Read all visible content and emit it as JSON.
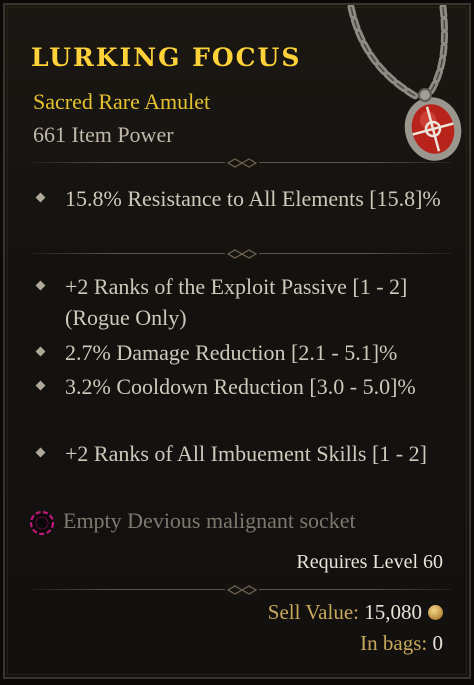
{
  "item": {
    "name": "Lurking Focus",
    "type": "Sacred Rare Amulet",
    "item_power": "661 Item Power",
    "implicit_affixes": [
      "15.8% Resistance to All Elements [15.8]%"
    ],
    "affixes": [
      "+2 Ranks of the Exploit Passive [1 - 2] (Rogue Only)",
      "2.7% Damage Reduction [2.1 - 5.1]%",
      "3.2% Cooldown Reduction [3.0 - 5.0]%",
      "+2 Ranks of All Imbuement Skills [1 - 2]"
    ],
    "socket": "Empty Devious malignant socket",
    "requirement": "Requires Level 60",
    "sell_label": "Sell Value:",
    "sell_value": "15,080",
    "bags_label": "In bags:",
    "bags_value": "0"
  },
  "icons": {
    "affix_bullet": "diamond-bullet-icon",
    "socket": "malignant-socket-icon",
    "gold": "gold-coin-icon",
    "item": "amulet-icon"
  },
  "colors": {
    "rare_name": "#ffd23a",
    "rare_type": "#e6c22f",
    "socket_ring": "#c2187a"
  }
}
